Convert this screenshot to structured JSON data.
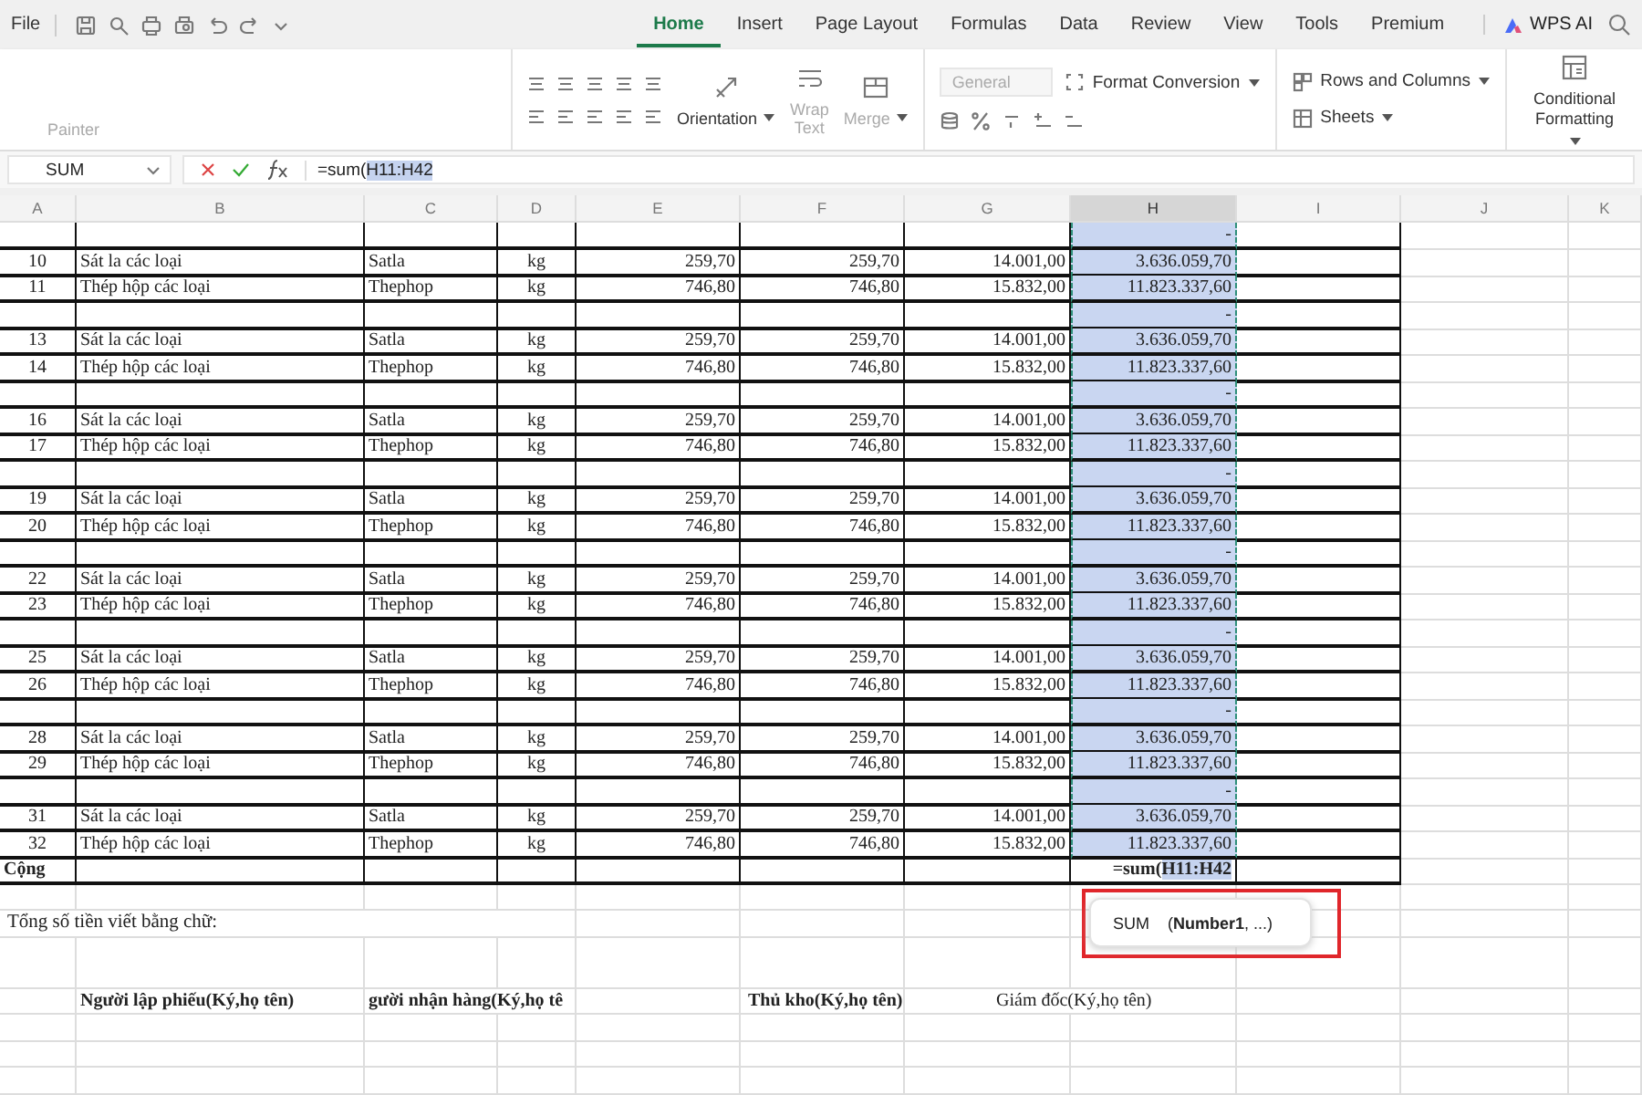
{
  "menu_bar": {
    "file": "File",
    "tabs": [
      {
        "label": "Home",
        "selected": true
      },
      {
        "label": "Insert",
        "selected": false
      },
      {
        "label": "Page Layout",
        "selected": false
      },
      {
        "label": "Formulas",
        "selected": false
      },
      {
        "label": "Data",
        "selected": false
      },
      {
        "label": "Review",
        "selected": false
      },
      {
        "label": "View",
        "selected": false
      },
      {
        "label": "Tools",
        "selected": false
      },
      {
        "label": "Premium",
        "selected": false
      }
    ],
    "ai_button": "WPS AI"
  },
  "ribbon": {
    "painter": "Painter",
    "orientation": "Orientation",
    "wrap_text": {
      "label": "Wrap Text",
      "disabled": true
    },
    "merge": {
      "label": "Merge",
      "disabled": true
    },
    "number_format": {
      "value": "General",
      "disabled": true
    },
    "format_conversion": "Format Conversion",
    "rows_and_columns": "Rows and Columns",
    "sheets": "Sheets",
    "conditional_formatting": "Conditional Formatting"
  },
  "formula_bar": {
    "name_box": "SUM",
    "formula_prefix": "=sum(",
    "formula_range": "H11:H42"
  },
  "sheet": {
    "columns": [
      {
        "label": "A",
        "selected": false
      },
      {
        "label": "B",
        "selected": false
      },
      {
        "label": "C",
        "selected": false
      },
      {
        "label": "D",
        "selected": false
      },
      {
        "label": "E",
        "selected": false
      },
      {
        "label": "F",
        "selected": false
      },
      {
        "label": "G",
        "selected": false
      },
      {
        "label": "H",
        "selected": true
      },
      {
        "label": "I",
        "selected": false
      },
      {
        "label": "J",
        "selected": false
      },
      {
        "label": "K",
        "selected": false
      }
    ],
    "rows": [
      {
        "kind": "spacer",
        "amount": "-"
      },
      {
        "kind": "item",
        "no": "10",
        "name": "Sát la các loại",
        "code": "Satla",
        "unit": "kg",
        "col_e": "259,70",
        "col_f": "259,70",
        "col_g": "14.001,00",
        "amount": "3.636.059,70"
      },
      {
        "kind": "item",
        "no": "11",
        "name": "Thép hộp các loại",
        "code": "Thephop",
        "unit": "kg",
        "col_e": "746,80",
        "col_f": "746,80",
        "col_g": "15.832,00",
        "amount": "11.823.337,60"
      },
      {
        "kind": "spacer",
        "amount": "-"
      },
      {
        "kind": "item",
        "no": "13",
        "name": "Sát la các loại",
        "code": "Satla",
        "unit": "kg",
        "col_e": "259,70",
        "col_f": "259,70",
        "col_g": "14.001,00",
        "amount": "3.636.059,70"
      },
      {
        "kind": "item",
        "no": "14",
        "name": "Thép hộp các loại",
        "code": "Thephop",
        "unit": "kg",
        "col_e": "746,80",
        "col_f": "746,80",
        "col_g": "15.832,00",
        "amount": "11.823.337,60"
      },
      {
        "kind": "spacer",
        "amount": "-"
      },
      {
        "kind": "item",
        "no": "16",
        "name": "Sát la các loại",
        "code": "Satla",
        "unit": "kg",
        "col_e": "259,70",
        "col_f": "259,70",
        "col_g": "14.001,00",
        "amount": "3.636.059,70"
      },
      {
        "kind": "item",
        "no": "17",
        "name": "Thép hộp các loại",
        "code": "Thephop",
        "unit": "kg",
        "col_e": "746,80",
        "col_f": "746,80",
        "col_g": "15.832,00",
        "amount": "11.823.337,60"
      },
      {
        "kind": "spacer",
        "amount": "-"
      },
      {
        "kind": "item",
        "no": "19",
        "name": "Sát la các loại",
        "code": "Satla",
        "unit": "kg",
        "col_e": "259,70",
        "col_f": "259,70",
        "col_g": "14.001,00",
        "amount": "3.636.059,70"
      },
      {
        "kind": "item",
        "no": "20",
        "name": "Thép hộp các loại",
        "code": "Thephop",
        "unit": "kg",
        "col_e": "746,80",
        "col_f": "746,80",
        "col_g": "15.832,00",
        "amount": "11.823.337,60"
      },
      {
        "kind": "spacer",
        "amount": "-"
      },
      {
        "kind": "item",
        "no": "22",
        "name": "Sát la các loại",
        "code": "Satla",
        "unit": "kg",
        "col_e": "259,70",
        "col_f": "259,70",
        "col_g": "14.001,00",
        "amount": "3.636.059,70"
      },
      {
        "kind": "item",
        "no": "23",
        "name": "Thép hộp các loại",
        "code": "Thephop",
        "unit": "kg",
        "col_e": "746,80",
        "col_f": "746,80",
        "col_g": "15.832,00",
        "amount": "11.823.337,60"
      },
      {
        "kind": "spacer",
        "amount": "-"
      },
      {
        "kind": "item",
        "no": "25",
        "name": "Sát la các loại",
        "code": "Satla",
        "unit": "kg",
        "col_e": "259,70",
        "col_f": "259,70",
        "col_g": "14.001,00",
        "amount": "3.636.059,70"
      },
      {
        "kind": "item",
        "no": "26",
        "name": "Thép hộp các loại",
        "code": "Thephop",
        "unit": "kg",
        "col_e": "746,80",
        "col_f": "746,80",
        "col_g": "15.832,00",
        "amount": "11.823.337,60"
      },
      {
        "kind": "spacer",
        "amount": "-"
      },
      {
        "kind": "item",
        "no": "28",
        "name": "Sát la các loại",
        "code": "Satla",
        "unit": "kg",
        "col_e": "259,70",
        "col_f": "259,70",
        "col_g": "14.001,00",
        "amount": "3.636.059,70"
      },
      {
        "kind": "item",
        "no": "29",
        "name": "Thép hộp các loại",
        "code": "Thephop",
        "unit": "kg",
        "col_e": "746,80",
        "col_f": "746,80",
        "col_g": "15.832,00",
        "amount": "11.823.337,60"
      },
      {
        "kind": "spacer",
        "amount": "-"
      },
      {
        "kind": "item",
        "no": "31",
        "name": "Sát la các loại",
        "code": "Satla",
        "unit": "kg",
        "col_e": "259,70",
        "col_f": "259,70",
        "col_g": "14.001,00",
        "amount": "3.636.059,70"
      },
      {
        "kind": "item",
        "no": "32",
        "name": "Thép hộp các loại",
        "code": "Thephop",
        "unit": "kg",
        "col_e": "746,80",
        "col_f": "746,80",
        "col_g": "15.832,00",
        "amount": "11.823.337,60"
      },
      {
        "kind": "total",
        "label": "Cộng",
        "formula_prefix": "=sum(",
        "formula_range": "H11:H42"
      }
    ],
    "amount_in_words": "Tổng số tiền viết bằng chữ:",
    "signatures": [
      {
        "text": "Người lập phiếu(Ký,họ tên)",
        "bold": true
      },
      {
        "text": "gười nhận hàng(Ký,họ tê",
        "bold": true
      },
      {
        "text": "Thủ kho(Ký,họ tên)",
        "bold": true
      },
      {
        "text": "Giám đốc(Ký,họ tên)",
        "bold": false
      }
    ]
  },
  "tooltip": {
    "function": "SUM",
    "args": "(**Number1**, ...)"
  }
}
